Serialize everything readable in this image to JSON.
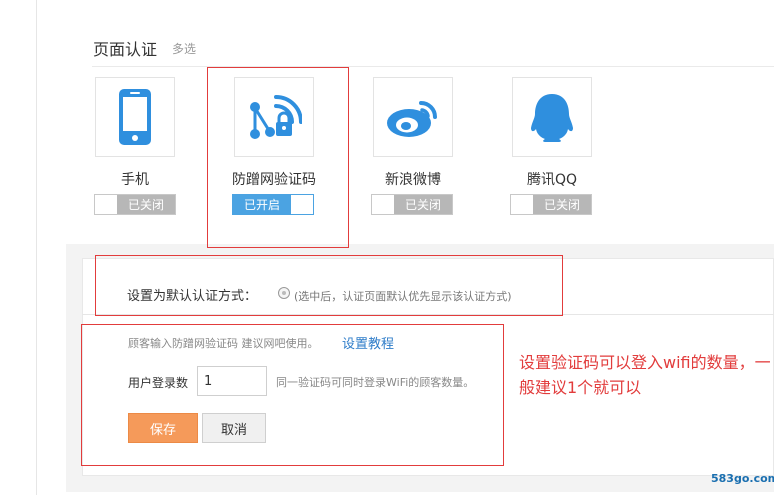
{
  "section": {
    "title": "页面认证",
    "subtitle": "多选"
  },
  "methods": [
    {
      "label": "手机",
      "status": "已关闭",
      "enabled": false,
      "icon": "phone-icon"
    },
    {
      "label": "防蹭网验证码",
      "status": "已开启",
      "enabled": true,
      "icon": "wifi-lock-icon"
    },
    {
      "label": "新浪微博",
      "status": "已关闭",
      "enabled": false,
      "icon": "weibo-icon"
    },
    {
      "label": "腾讯QQ",
      "status": "已关闭",
      "enabled": false,
      "icon": "qq-icon"
    }
  ],
  "default_auth": {
    "label": "设置为默认认证方式：",
    "hint": "(选中后，认证页面默认优先显示该认证方式)",
    "selected": false
  },
  "config": {
    "hint": "顾客输入防蹭网验证码 建议网吧使用。",
    "tutorial_link": "设置教程",
    "login_count_label": "用户登录数",
    "login_count_value": "1",
    "login_count_hint": "同一验证码可同时登录WiFi的顾客数量。"
  },
  "buttons": {
    "save": "保存",
    "cancel": "取消"
  },
  "annotation": "设置验证码可以登入wifi的数量，一般建议1个就可以",
  "watermark": "583go.com",
  "colors": {
    "accent": "#4ba3e2",
    "save": "#f59a5a",
    "highlight": "#e23c3c",
    "link": "#2f7dc9"
  }
}
